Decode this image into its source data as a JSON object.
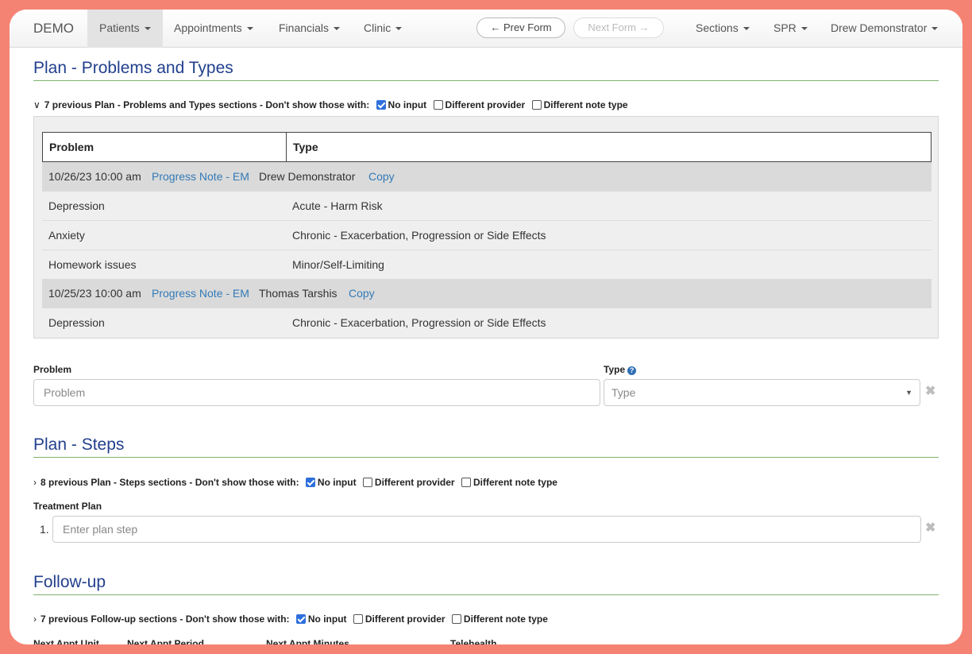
{
  "nav": {
    "brand": "DEMO",
    "patients": "Patients",
    "appointments": "Appointments",
    "financials": "Financials",
    "clinic": "Clinic",
    "prev_form": "← Prev Form",
    "next_form": "Next Form →",
    "sections": "Sections",
    "spr": "SPR",
    "user": "Drew Demonstrator"
  },
  "filter": {
    "prefix": "Don't show those with:",
    "no_input": "No input",
    "different_provider": "Different provider",
    "different_note_type": "Different note type"
  },
  "problems": {
    "title": "Plan - Problems and Types",
    "previous_label": "7 previous Plan - Problems and Types sections -",
    "table_headers": {
      "problem": "Problem",
      "type": "Type"
    },
    "groups": [
      {
        "date": "10/26/23 10:00 am",
        "note": "Progress Note - EM",
        "provider": "Drew Demonstrator",
        "copy": "Copy",
        "rows": [
          {
            "problem": "Depression",
            "type": "Acute - Harm Risk"
          },
          {
            "problem": "Anxiety",
            "type": "Chronic - Exacerbation, Progression or Side Effects"
          },
          {
            "problem": "Homework issues",
            "type": "Minor/Self-Limiting"
          }
        ]
      },
      {
        "date": "10/25/23 10:00 am",
        "note": "Progress Note - EM",
        "provider": "Thomas Tarshis",
        "copy": "Copy",
        "rows": [
          {
            "problem": "Depression",
            "type": "Chronic - Exacerbation, Progression or Side Effects"
          }
        ]
      }
    ],
    "form": {
      "problem_label": "Problem",
      "problem_placeholder": "Problem",
      "type_label": "Type",
      "type_placeholder": "Type"
    }
  },
  "steps": {
    "title": "Plan - Steps",
    "previous_label": "8 previous Plan - Steps sections -",
    "treatment_plan_label": "Treatment Plan",
    "step_number": "1.",
    "step_placeholder": "Enter plan step"
  },
  "followup": {
    "title": "Follow-up",
    "previous_label": "7 previous Follow-up sections -",
    "columns": [
      "Next Appt Unit",
      "Next Appt Period",
      "Next Appt Minutes",
      "Telehealth"
    ]
  }
}
